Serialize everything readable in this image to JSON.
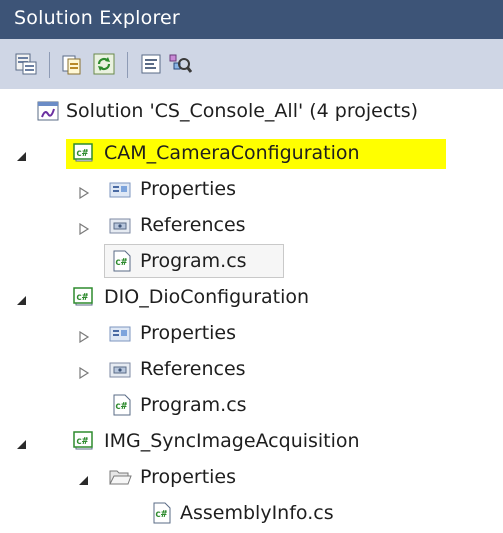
{
  "window": {
    "title": "Solution Explorer"
  },
  "toolbar": {
    "buttons": [
      {
        "name": "properties-icon"
      },
      {
        "name": "show-all-files-icon"
      },
      {
        "name": "refresh-icon"
      },
      {
        "name": "view-code-icon"
      },
      {
        "name": "class-view-icon"
      }
    ]
  },
  "tree": {
    "solution_label": "Solution 'CS_Console_All' (4 projects)",
    "projects": [
      {
        "label": "CAM_CameraConfiguration",
        "children": [
          {
            "label": "Properties"
          },
          {
            "label": "References"
          },
          {
            "label": "Program.cs"
          }
        ]
      },
      {
        "label": "DIO_DioConfiguration",
        "children": [
          {
            "label": "Properties"
          },
          {
            "label": "References"
          },
          {
            "label": "Program.cs"
          }
        ]
      },
      {
        "label": "IMG_SyncImageAcquisition",
        "children": [
          {
            "label": "Properties"
          },
          {
            "label": "AssemblyInfo.cs"
          }
        ]
      }
    ]
  },
  "colors": {
    "titlebar": "#3d5477",
    "toolbar": "#cfd6e5",
    "highlight": "#ffff00",
    "csharp_green": "#2e8b2e"
  }
}
